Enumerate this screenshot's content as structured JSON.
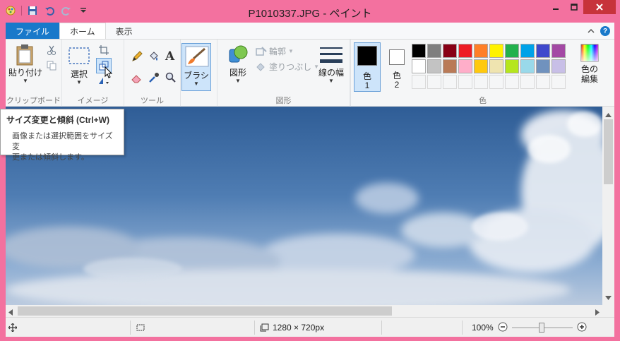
{
  "window": {
    "title": "P1010337.JPG - ペイント"
  },
  "tabs": [
    {
      "label": "ファイル"
    },
    {
      "label": "ホーム"
    },
    {
      "label": "表示"
    }
  ],
  "ribbon": {
    "clipboard": {
      "paste_label": "貼り付け",
      "group_label": "クリップボード"
    },
    "image": {
      "select_label": "選択",
      "group_label": "イメージ"
    },
    "tools": {
      "group_label": "ツール"
    },
    "brush": {
      "label": "ブラシ"
    },
    "shapes": {
      "shape_label": "図形",
      "outline_label": "輪郭",
      "fill_label": "塗りつぶし",
      "group_label": "図形"
    },
    "size": {
      "label": "線の幅"
    },
    "colors": {
      "color1_label": "色",
      "color1_num": "1",
      "color2_label": "色",
      "color2_num": "2",
      "edit_label1": "色の",
      "edit_label2": "編集",
      "group_label": "色",
      "color1": "#000000",
      "color2": "#ffffff",
      "palette_row1": [
        "#000000",
        "#7f7f7f",
        "#880015",
        "#ed1c24",
        "#ff7f27",
        "#fff200",
        "#22b14c",
        "#00a2e8",
        "#3f48cc",
        "#a349a4"
      ],
      "palette_row2": [
        "#ffffff",
        "#c3c3c3",
        "#b97a57",
        "#ffaec9",
        "#ffc90e",
        "#efe4b0",
        "#b5e61d",
        "#99d9ea",
        "#7092be",
        "#c8bfe7"
      ]
    }
  },
  "tooltip": {
    "title": "サイズ変更と傾斜 (Ctrl+W)",
    "line1": "画像または選択範囲をサイズ変",
    "line2": "更または傾斜します。"
  },
  "status": {
    "dimensions": "1280 × 720px",
    "zoom": "100%"
  }
}
